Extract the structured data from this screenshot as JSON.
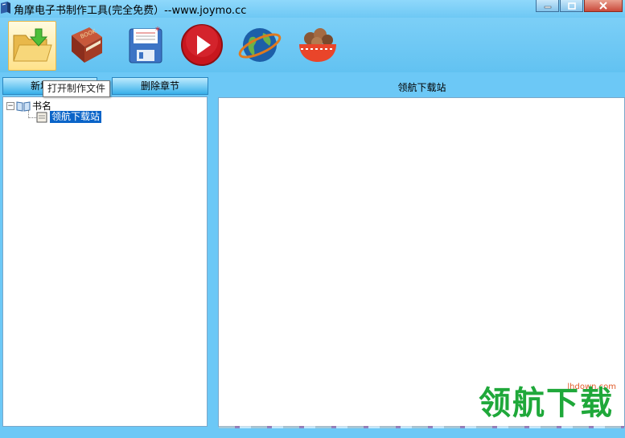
{
  "window": {
    "title": "角摩电子书制作工具(完全免费）--www.joymo.cc",
    "minimize_icon": "minimize-icon",
    "maximize_icon": "maximize-icon",
    "close_icon": "close-icon"
  },
  "toolbar": {
    "buttons": [
      {
        "icon": "open-folder-icon"
      },
      {
        "icon": "book-icon"
      },
      {
        "icon": "save-floppy-icon"
      },
      {
        "icon": "play-icon"
      },
      {
        "icon": "globe-icon"
      },
      {
        "icon": "cookie-bowl-icon"
      }
    ]
  },
  "tabs": {
    "new_chapter": "新增章节",
    "delete_chapter": "删除章节"
  },
  "tooltip": "打开制作文件",
  "tree": {
    "root_label": "书名",
    "child_label": "领航下载站"
  },
  "content": {
    "title": "领航下载站"
  },
  "watermark": {
    "text": "领航下载",
    "url": "lhdown.com"
  },
  "colors": {
    "background": "#6cc8f6",
    "selection": "#0a64c8",
    "watermark": "#1fa83a"
  }
}
